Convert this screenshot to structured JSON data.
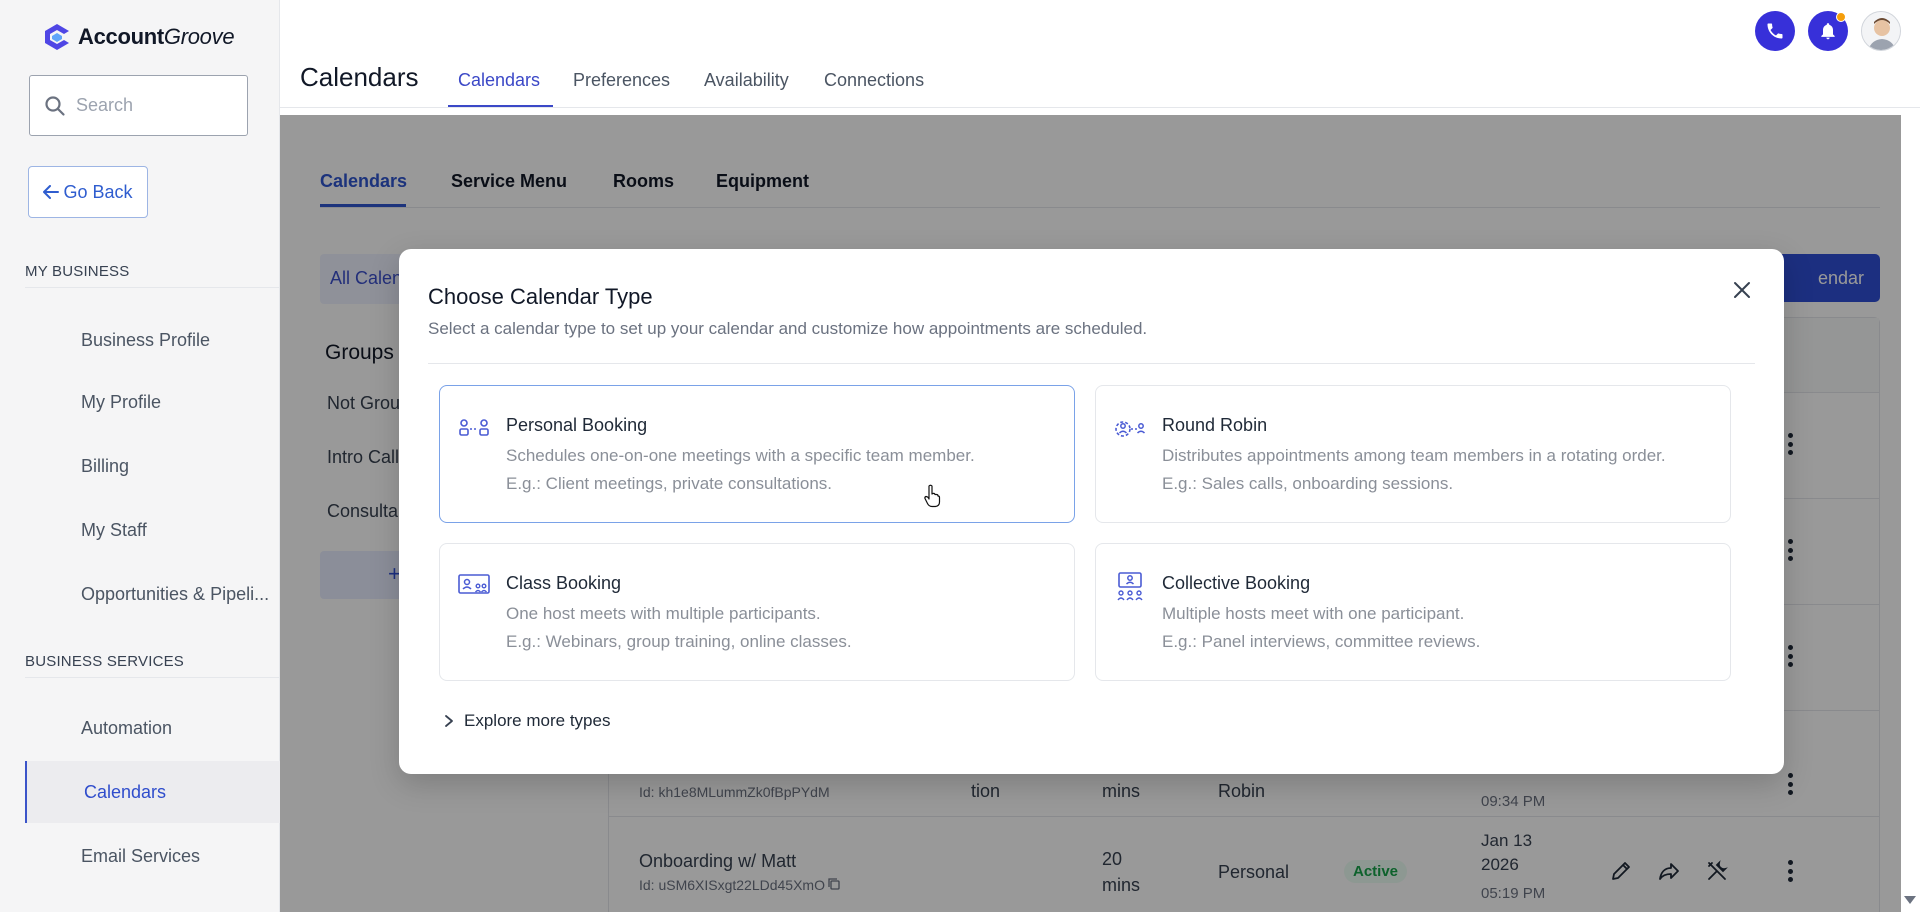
{
  "brand": {
    "name_bold": "Account",
    "name_italic": "Groove"
  },
  "search": {
    "placeholder": "Search"
  },
  "sidebar": {
    "go_back": "Go Back",
    "sections": [
      {
        "heading": "MY BUSINESS"
      },
      {
        "heading": "BUSINESS SERVICES"
      }
    ],
    "items": [
      {
        "label": "Business Profile"
      },
      {
        "label": "My Profile"
      },
      {
        "label": "Billing"
      },
      {
        "label": "My Staff"
      },
      {
        "label": "Opportunities & Pipeli..."
      },
      {
        "label": "Automation"
      },
      {
        "label": "Calendars"
      },
      {
        "label": "Email Services"
      }
    ],
    "active_item": "Calendars"
  },
  "header": {
    "title": "Calendars",
    "tabs": [
      {
        "label": "Calendars"
      },
      {
        "label": "Preferences"
      },
      {
        "label": "Availability"
      },
      {
        "label": "Connections"
      }
    ],
    "active_tab": "Calendars"
  },
  "main": {
    "subtabs": [
      {
        "label": "Calendars"
      },
      {
        "label": "Service Menu"
      },
      {
        "label": "Rooms"
      },
      {
        "label": "Equipment"
      }
    ],
    "filter_chip": "All Calen",
    "create_button": "endar",
    "groups_title": "Groups",
    "groups": [
      {
        "label": "Not Grou"
      },
      {
        "label": "Intro Call"
      },
      {
        "label": "Consulta"
      }
    ],
    "add_group": "+",
    "rows": [
      {
        "id": "Id: kh1e8MLummZk0fBpPYdM",
        "type": "tion",
        "duration": "mins",
        "kind": "Robin",
        "time": "09:34 PM"
      },
      {
        "name": "Onboarding w/ Matt",
        "id": "Id: uSM6XISxgt22LDd45XmO",
        "duration_value": "20",
        "duration_unit": "mins",
        "kind": "Personal",
        "status": "Active",
        "date_line1": "Jan 13",
        "date_line2": "2026",
        "time": "05:19 PM"
      }
    ]
  },
  "modal": {
    "title": "Choose Calendar Type",
    "subtitle": "Select a calendar type to set up your calendar and customize how appointments are scheduled.",
    "types": [
      {
        "title": "Personal Booking",
        "desc": "Schedules one-on-one meetings with a specific team member.",
        "example": "E.g.: Client meetings, private consultations.",
        "icon": "personal-booking-icon"
      },
      {
        "title": "Round Robin",
        "desc": "Distributes appointments among team members in a rotating order.",
        "example": "E.g.: Sales calls, onboarding sessions.",
        "icon": "round-robin-icon"
      },
      {
        "title": "Class Booking",
        "desc": "One host meets with multiple participants.",
        "example": "E.g.: Webinars, group training, online classes.",
        "icon": "class-booking-icon"
      },
      {
        "title": "Collective Booking",
        "desc": "Multiple hosts meet with one participant.",
        "example": "E.g.: Panel interviews, committee reviews.",
        "icon": "collective-booking-icon"
      }
    ],
    "selected_type": "Personal Booking",
    "explore_more": "Explore more types"
  },
  "colors": {
    "accent": "#3b48c7",
    "primary_button": "#2f4fd6",
    "phone_button": "#3730d9",
    "notification_dot": "#f59e0b",
    "active_badge": "#16a34a",
    "selected_card_border": "#7aa2e8"
  }
}
